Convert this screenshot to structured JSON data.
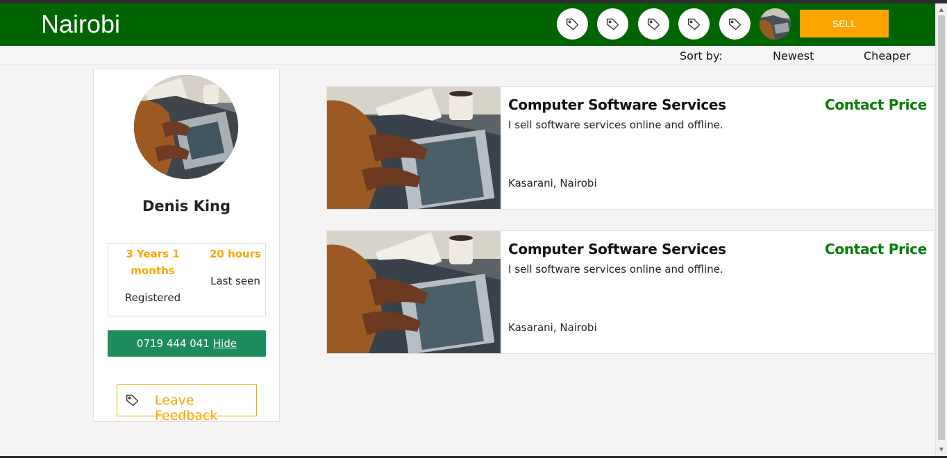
{
  "header": {
    "brand": "Nairobi",
    "sell_label": "SELL"
  },
  "sort": {
    "label": "Sort by:",
    "newest": "Newest",
    "cheaper": "Cheaper"
  },
  "profile": {
    "name": "Denis King",
    "registered_value": "3 Years 1 months",
    "registered_label": "Registered",
    "last_seen_value": "20 hours",
    "last_seen_label": "Last seen",
    "phone": "0719 444 041",
    "hide_label": "Hide",
    "feedback_label": "Leave Feedback"
  },
  "listings": [
    {
      "title": "Computer Software Services",
      "price": "Contact Price",
      "description": "I sell software services online and offline.",
      "location": "Kasarani, Nairobi"
    },
    {
      "title": "Computer Software Services",
      "price": "Contact Price",
      "description": "I sell software services online and offline.",
      "location": "Kasarani, Nairobi"
    }
  ],
  "icons": {
    "tag": "tag-icon",
    "feedback": "tag-icon"
  },
  "colors": {
    "header_green": "#006400",
    "accent_orange": "#ffa500",
    "price_green": "#008000",
    "phone_button": "#1e8b5c"
  }
}
